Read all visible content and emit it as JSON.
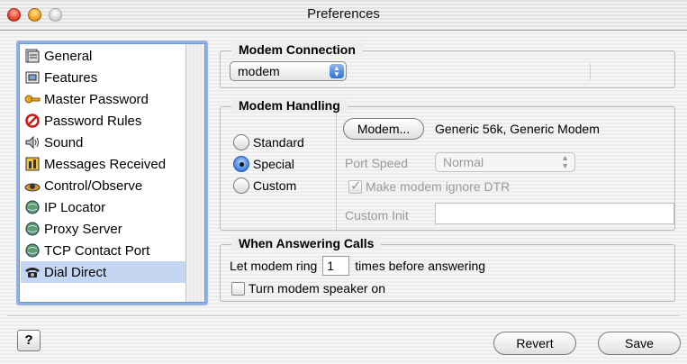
{
  "window": {
    "title": "Preferences"
  },
  "sidebar": {
    "items": [
      {
        "label": "General",
        "icon": "general-icon"
      },
      {
        "label": "Features",
        "icon": "features-icon"
      },
      {
        "label": "Master Password",
        "icon": "key-icon"
      },
      {
        "label": "Password Rules",
        "icon": "prohibited-icon"
      },
      {
        "label": "Sound",
        "icon": "speaker-icon"
      },
      {
        "label": "Messages Received",
        "icon": "messages-icon"
      },
      {
        "label": "Control/Observe",
        "icon": "eye-icon"
      },
      {
        "label": "IP Locator",
        "icon": "globe-icon"
      },
      {
        "label": "Proxy Server",
        "icon": "globe-icon"
      },
      {
        "label": "TCP Contact Port",
        "icon": "globe-icon"
      },
      {
        "label": "Dial Direct",
        "icon": "phone-icon",
        "selected": true
      }
    ]
  },
  "modem_connection": {
    "title": "Modem Connection",
    "selected": "modem"
  },
  "modem_handling": {
    "title": "Modem Handling",
    "radios": [
      {
        "label": "Standard",
        "checked": false
      },
      {
        "label": "Special",
        "checked": true
      },
      {
        "label": "Custom",
        "checked": false
      }
    ],
    "modem_button": "Modem...",
    "modem_name": "Generic 56k, Generic Modem",
    "port_speed_label": "Port Speed",
    "port_speed_value": "Normal",
    "ignore_dtr_label": "Make modem ignore DTR",
    "ignore_dtr_checked": true,
    "custom_init_label": "Custom Init",
    "custom_init_value": ""
  },
  "answering": {
    "title": "When Answering Calls",
    "ring_prefix": "Let modem ring",
    "ring_count": "1",
    "ring_suffix": "times before answering",
    "speaker_label": "Turn modem speaker on",
    "speaker_checked": false
  },
  "footer": {
    "help": "?",
    "revert": "Revert",
    "save": "Save"
  },
  "colors": {
    "selection": "#c5d6f2",
    "focus_ring": "#8fb1e3",
    "accent": "#2d6fd6"
  }
}
